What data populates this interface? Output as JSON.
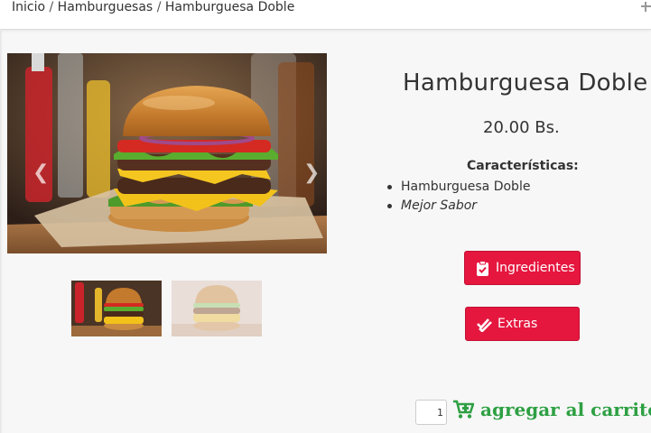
{
  "breadcrumb": {
    "items": [
      "Inicio",
      "Hamburguesas",
      "Hamburguesa Doble"
    ],
    "separator": "/"
  },
  "product": {
    "title": "Hamburguesa Doble",
    "price": "20.00 Bs.",
    "features_title": "Características:",
    "features": [
      "Hamburguesa Doble",
      "Mejor Sabor"
    ]
  },
  "gallery": {
    "prev_icon": "chevron-left-icon",
    "next_icon": "chevron-right-icon",
    "thumbnail_count": 2
  },
  "buttons": {
    "ingredientes_label": "Ingredientes",
    "extras_label": "Extras",
    "add_to_cart_label": "agregar al carrito"
  },
  "cart": {
    "quantity": "1"
  },
  "colors": {
    "primary_button": "#e5173f",
    "cart_green": "#2ea043",
    "background": "#f7f7f7"
  }
}
